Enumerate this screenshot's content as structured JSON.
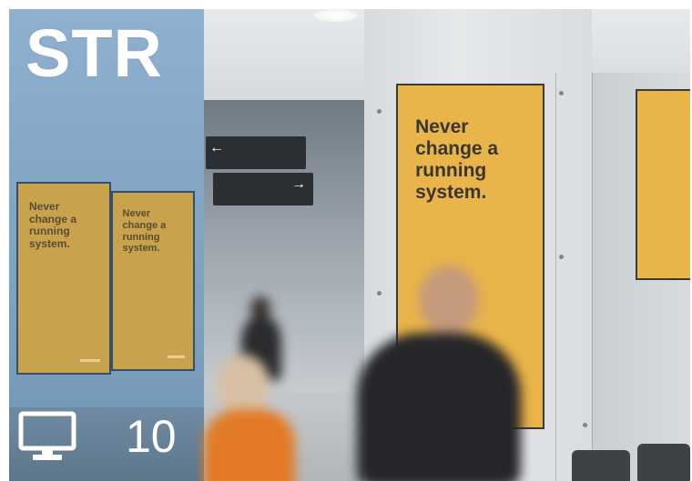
{
  "brand": {
    "label": "STR"
  },
  "screens": {
    "icon": "monitor-icon",
    "count": "10"
  },
  "posters": {
    "tagline": "Never\nchange a\nrunning\nsystem."
  },
  "colors": {
    "overlay_blue": "#86a8c6",
    "poster_yellow": "#e9b449",
    "text_white": "#ffffff"
  }
}
